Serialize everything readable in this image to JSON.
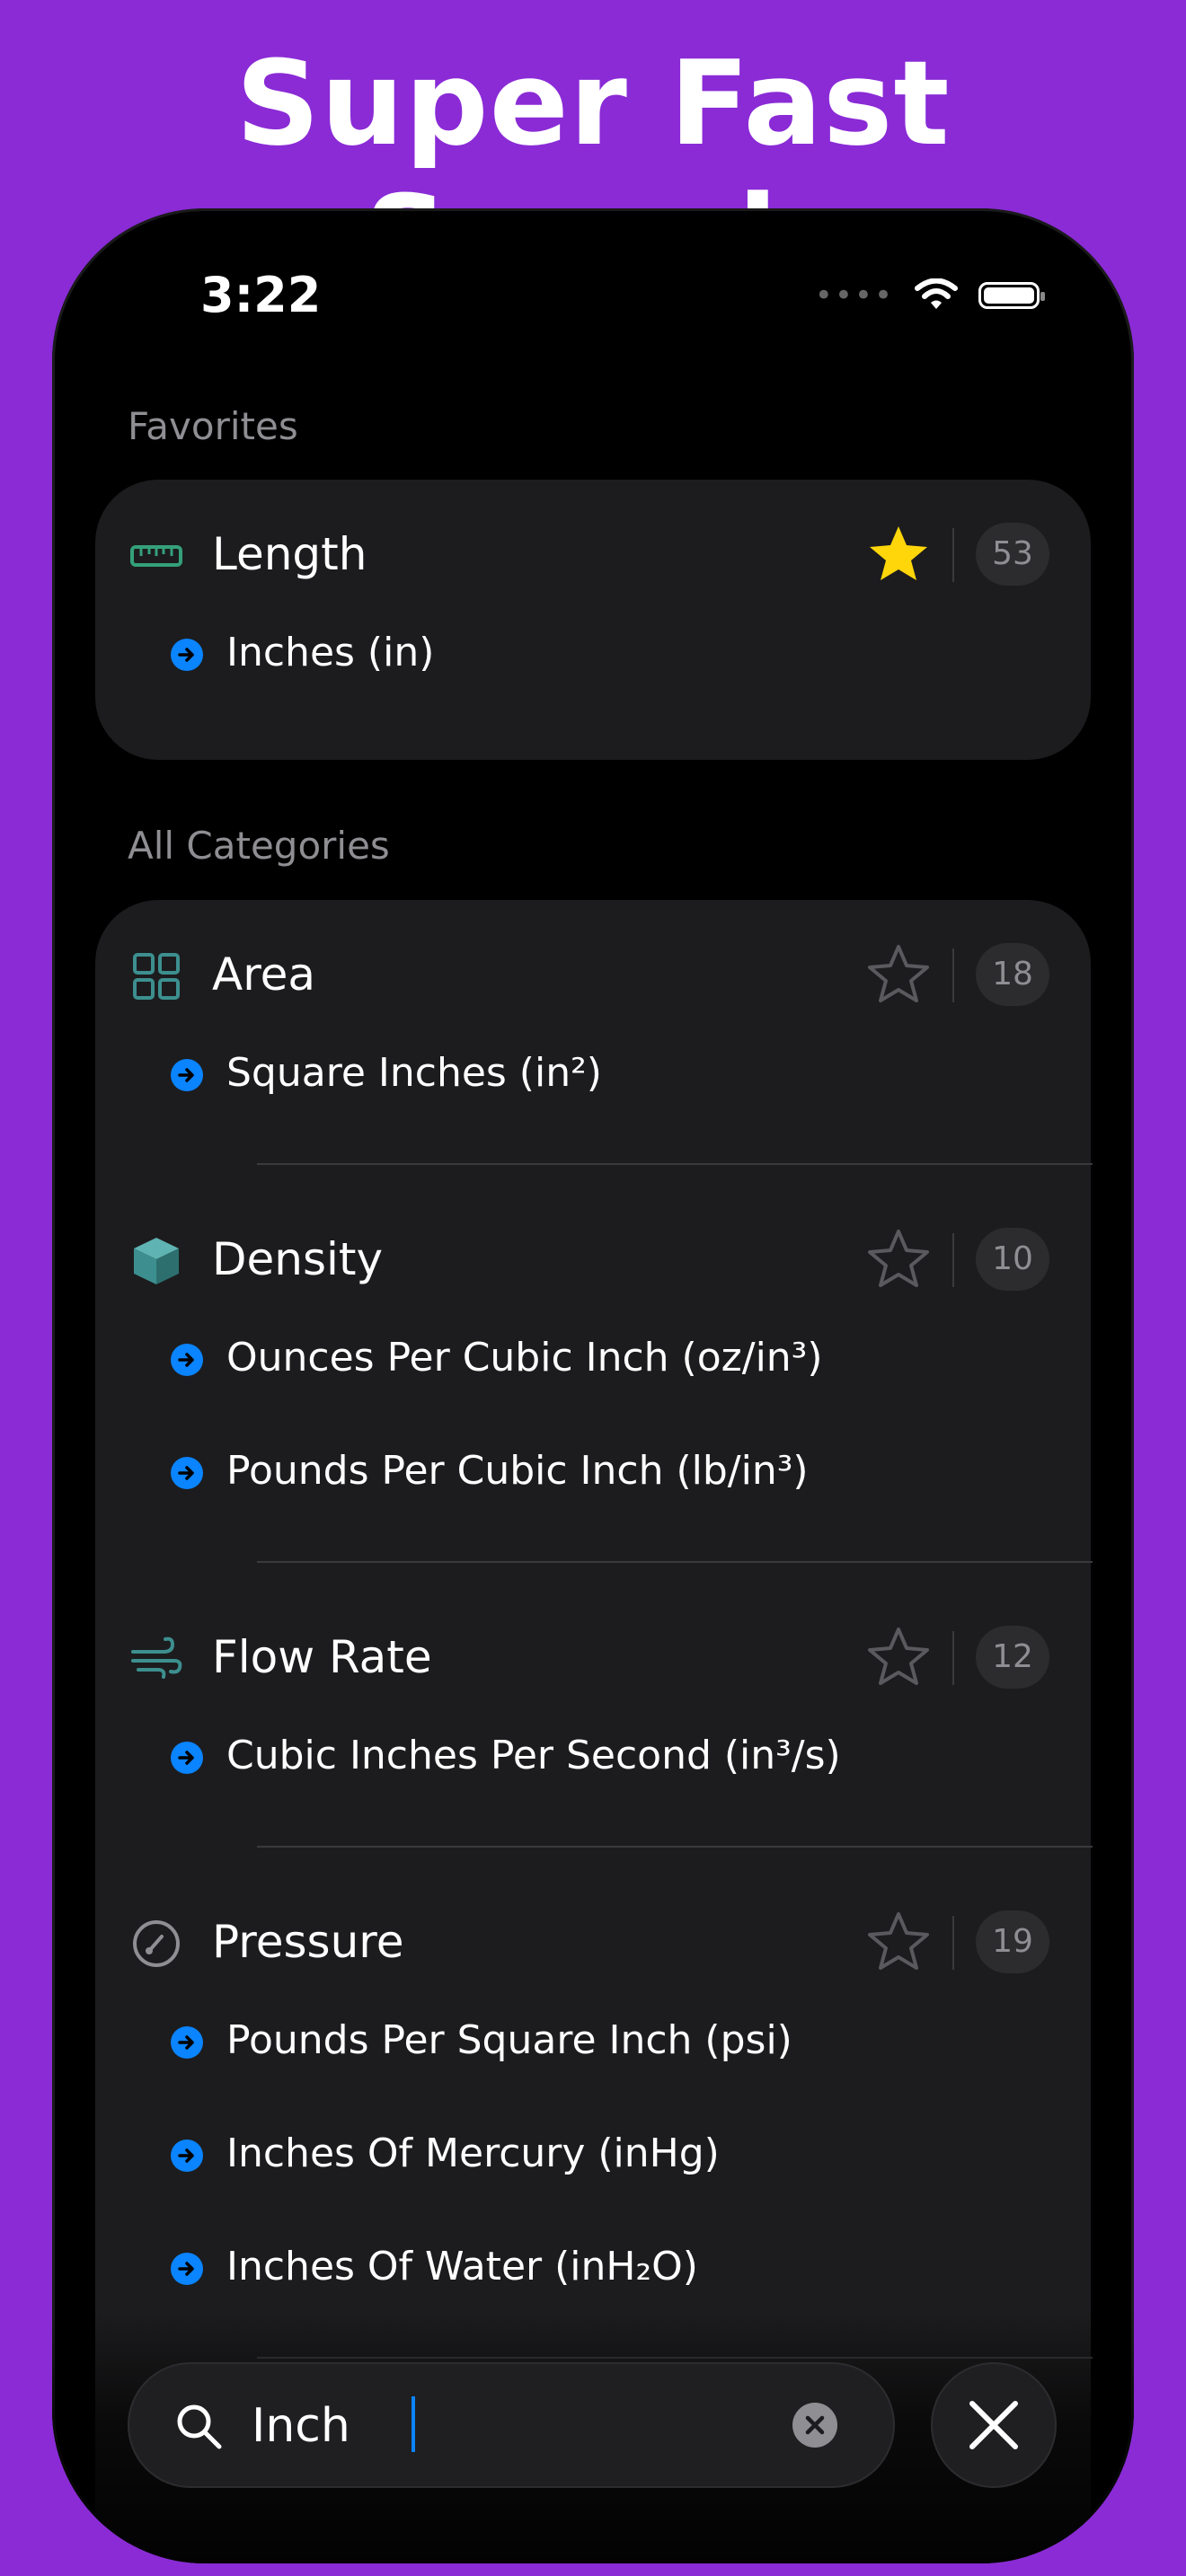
{
  "headline": "Super Fast Search",
  "status": {
    "time": "3:22"
  },
  "favorites": {
    "label": "Favorites",
    "category": {
      "title": "Length",
      "count": "53",
      "favorited": true,
      "icon": "ruler-icon"
    },
    "units": [
      "Inches (in)"
    ]
  },
  "all_categories": {
    "label": "All Categories",
    "categories": [
      {
        "title": "Area",
        "count": "18",
        "icon": "grid-icon",
        "units": [
          "Square Inches (in²)"
        ]
      },
      {
        "title": "Density",
        "count": "10",
        "icon": "cube-icon",
        "units": [
          "Ounces Per Cubic Inch (oz/in³)",
          "Pounds Per Cubic Inch (lb/in³)"
        ]
      },
      {
        "title": "Flow Rate",
        "count": "12",
        "icon": "wind-icon",
        "units": [
          "Cubic Inches Per Second (in³/s)"
        ]
      },
      {
        "title": "Pressure",
        "count": "19",
        "icon": "gauge-icon",
        "units": [
          "Pounds Per Square Inch (psi)",
          "Inches Of Mercury (inHg)",
          "Inches Of Water (inH₂O)"
        ]
      }
    ]
  },
  "search": {
    "value": "Inch"
  },
  "colors": {
    "background": "#8a2bd6",
    "accent": "#0a84ff",
    "star_active": "#ffd60a",
    "card": "#1c1c1e",
    "icon_teal": "#3d8f8f"
  }
}
